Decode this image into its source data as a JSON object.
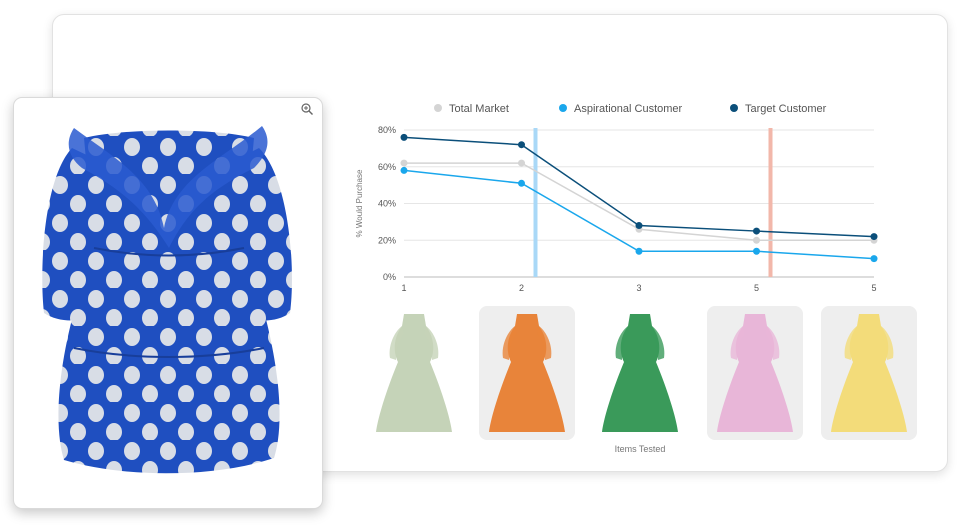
{
  "chart_data": {
    "type": "line",
    "x": [
      "1",
      "2",
      "3",
      "5",
      "5"
    ],
    "ylabel": "% Would Purchase",
    "xlabel": "Items Tested",
    "y_ticks": [
      "0%",
      "20%",
      "40%",
      "60%",
      "80%"
    ],
    "ylim": [
      0,
      80
    ],
    "legend_position": "top",
    "grid": true,
    "series": [
      {
        "name": "Total Market",
        "color": "#d4d4d4",
        "values": [
          62,
          62,
          26,
          20,
          20
        ]
      },
      {
        "name": "Aspirational Customer",
        "color": "#1aa7ec",
        "values": [
          58,
          51,
          14,
          14,
          10
        ]
      },
      {
        "name": "Target Customer",
        "color": "#0b4f7a",
        "values": [
          76,
          72,
          28,
          25,
          22
        ]
      }
    ],
    "markers": [
      {
        "after_index": 1,
        "color": "#a9d8f7"
      },
      {
        "after_index": 3,
        "color": "#f2b7aa"
      }
    ]
  },
  "thumbnails": [
    {
      "name": "sage floral midi dress",
      "color": "#c5d3b8",
      "background": false
    },
    {
      "name": "orange button sundress",
      "color": "#e8843a",
      "background": true
    },
    {
      "name": "green wrap shirt dress",
      "color": "#3a9a5a",
      "background": false
    },
    {
      "name": "pink one-shoulder dress",
      "color": "#e8b6d8",
      "background": true
    },
    {
      "name": "yellow tiered sundress",
      "color": "#f3dc7a",
      "background": true
    }
  ],
  "product": {
    "name": "blue polka dot ruffle dress",
    "color": "#1f4fc0"
  }
}
